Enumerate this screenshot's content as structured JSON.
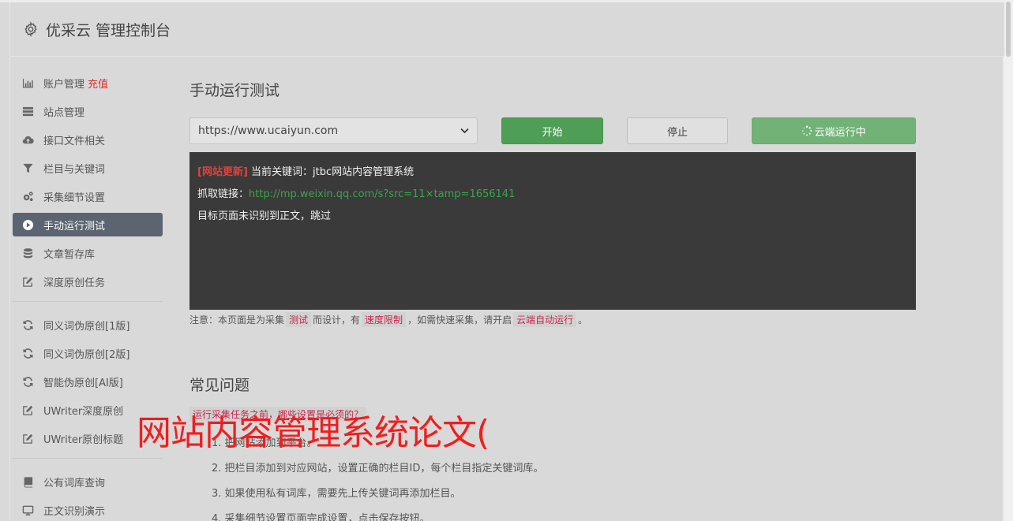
{
  "header": {
    "title": "优采云 管理控制台"
  },
  "sidebar": {
    "group1": [
      {
        "label": "账户管理",
        "extra": "充值",
        "icon": "bar-chart-icon"
      },
      {
        "label": "站点管理",
        "icon": "server-icon"
      },
      {
        "label": "接口文件相关",
        "icon": "cloud-upload-icon"
      },
      {
        "label": "栏目与关键词",
        "icon": "filter-icon"
      },
      {
        "label": "采集细节设置",
        "icon": "cogs-icon"
      },
      {
        "label": "手动运行测试",
        "icon": "play-circle-icon",
        "active": true
      },
      {
        "label": "文章暂存库",
        "icon": "database-icon"
      },
      {
        "label": "深度原创任务",
        "icon": "edit-icon"
      }
    ],
    "group2": [
      {
        "label": "同义词伪原创[1版]",
        "icon": "refresh-icon"
      },
      {
        "label": "同义词伪原创[2版]",
        "icon": "refresh-icon"
      },
      {
        "label": "智能伪原创[AI版]",
        "icon": "refresh-icon"
      },
      {
        "label": "UWriter深度原创",
        "icon": "edit-icon"
      },
      {
        "label": "UWriter原创标题",
        "icon": "edit-icon"
      }
    ],
    "group3": [
      {
        "label": "公有词库查询",
        "icon": "book-icon"
      },
      {
        "label": "正文识别演示",
        "icon": "monitor-icon"
      }
    ]
  },
  "main": {
    "title": "手动运行测试",
    "site_select": {
      "value": "https://www.ucaiyun.com"
    },
    "buttons": {
      "start": "开始",
      "stop": "停止",
      "cloud": "云端运行中"
    },
    "console": {
      "line1_tag": "[网站更新]",
      "line1_text": " 当前关键词：jtbc网站内容管理系统",
      "line2_label": "抓取链接：",
      "line2_link": "http://mp.weixin.qq.com/s?src=11×tamp=1656141",
      "line3": "目标页面未识别到正文，跳过"
    },
    "notice": {
      "p1": "注意：本页面是为采集",
      "c1": "测试",
      "p2": "而设计，有",
      "c2": "速度限制",
      "p3": "，如需快速采集，请开启",
      "c3": "云端自动运行",
      "p4": "。"
    }
  },
  "faq": {
    "title": "常见问题",
    "question": "运行采集任务之前，哪些设置是必须的？",
    "items": [
      "1. 把网站添加到平台。",
      "2. 把栏目添加到对应网站，设置正确的栏目ID，每个栏目指定关键词库。",
      "3. 如果使用私有词库，需要先上传关键词再添加栏目。",
      "4. 采集细节设置页面完成设置，点击保存按钮。"
    ]
  },
  "overlay_text": "网站内容管理系统论文(",
  "colors": {
    "active_nav": "#5b6470",
    "start": "#4e9e55",
    "cloud": "#72b277",
    "console_bg": "#3a3a3a",
    "tag": "#e0433f",
    "link": "#3ba44c",
    "overlay": "#f21d1d"
  }
}
